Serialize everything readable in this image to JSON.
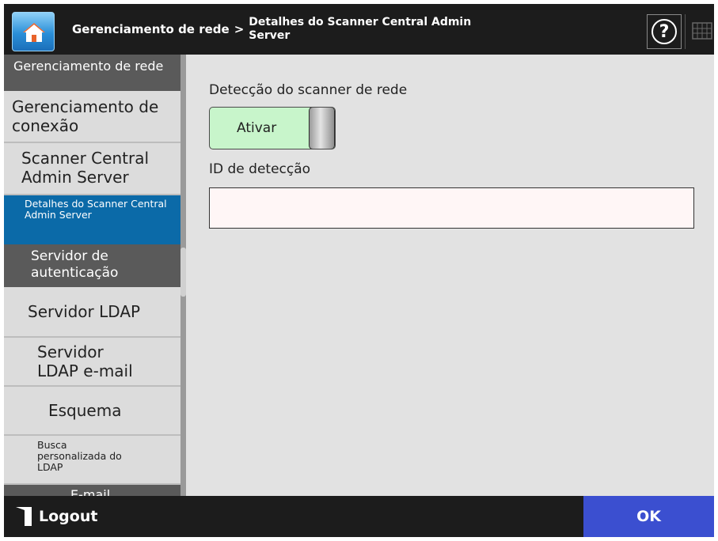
{
  "header": {
    "breadcrumb_main": "Gerenciamento de rede",
    "breadcrumb_separator": ">",
    "breadcrumb_sub": "Detalhes do Scanner Central Admin Server"
  },
  "sidebar": {
    "items": [
      {
        "label": "Gerenciamento de rede",
        "state": "section"
      },
      {
        "label": "Gerenciamento de conexão",
        "state": "item"
      },
      {
        "label": "Scanner Central Admin Server",
        "state": "item"
      },
      {
        "label": "Detalhes do Scanner Central Admin Server",
        "state": "selected"
      },
      {
        "label": "Servidor de autenticação",
        "state": "section"
      },
      {
        "label": "Servidor LDAP",
        "state": "item"
      },
      {
        "label": "Servidor LDAP e-mail",
        "state": "item"
      },
      {
        "label": "Esquema",
        "state": "item"
      },
      {
        "label": "Busca personalizada do LDAP",
        "state": "item"
      },
      {
        "label": "E-mail",
        "state": "section"
      }
    ]
  },
  "main": {
    "detection_label": "Detecção do scanner de rede",
    "toggle_label": "Ativar",
    "toggle_state": "on",
    "id_label": "ID de detecção",
    "id_value": ""
  },
  "footer": {
    "logout_label": "Logout",
    "ok_label": "OK"
  },
  "colors": {
    "header_bg": "#1c1c1c",
    "selected_bg": "#0b6aa8",
    "content_bg": "#e2e2e2",
    "toggle_on": "#c8f5cb",
    "ok_button": "#3b4fd0"
  },
  "icons": [
    "home-icon",
    "help-icon",
    "keyboard-icon",
    "logout-icon"
  ]
}
